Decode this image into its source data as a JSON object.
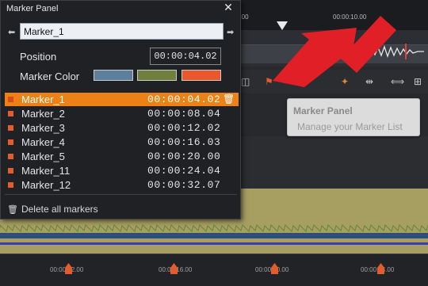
{
  "panel": {
    "title": "Marker Panel",
    "close_glyph": "✕",
    "prev_glyph": "⬅",
    "next_glyph": "➡",
    "name_value": "Marker_1",
    "position_label": "Position",
    "position_value": "00:00:04.02",
    "color_label": "Marker Color",
    "colors": [
      "#5d7f9c",
      "#717f3c",
      "#e9572a"
    ],
    "markers": [
      {
        "name": "Marker_1",
        "time": "00:00:04.02",
        "selected": true
      },
      {
        "name": "Marker_2",
        "time": "00:00:08.04"
      },
      {
        "name": "Marker_3",
        "time": "00:00:12.02"
      },
      {
        "name": "Marker_4",
        "time": "00:00:16.03"
      },
      {
        "name": "Marker_5",
        "time": "00:00:20.00"
      },
      {
        "name": "Marker_11",
        "time": "00:00:24.04"
      },
      {
        "name": "Marker_12",
        "time": "00:00:32.07"
      }
    ],
    "delete_all_label": "Delete all markers",
    "trash_icon": "trash-icon"
  },
  "background": {
    "ruler_ticks": [
      "1:00",
      "00:00:10.00"
    ],
    "preview_text": "t",
    "tooltip_title": "Marker Panel",
    "tooltip_subtitle": "Manage your Marker List",
    "bottom_ticks": [
      "00:00:12.00",
      "00:00:16.00",
      "00:00:20.00",
      "00:00:24.00"
    ],
    "accent_color": "#e8842a",
    "marker_pin_color": "#e25d2e"
  }
}
